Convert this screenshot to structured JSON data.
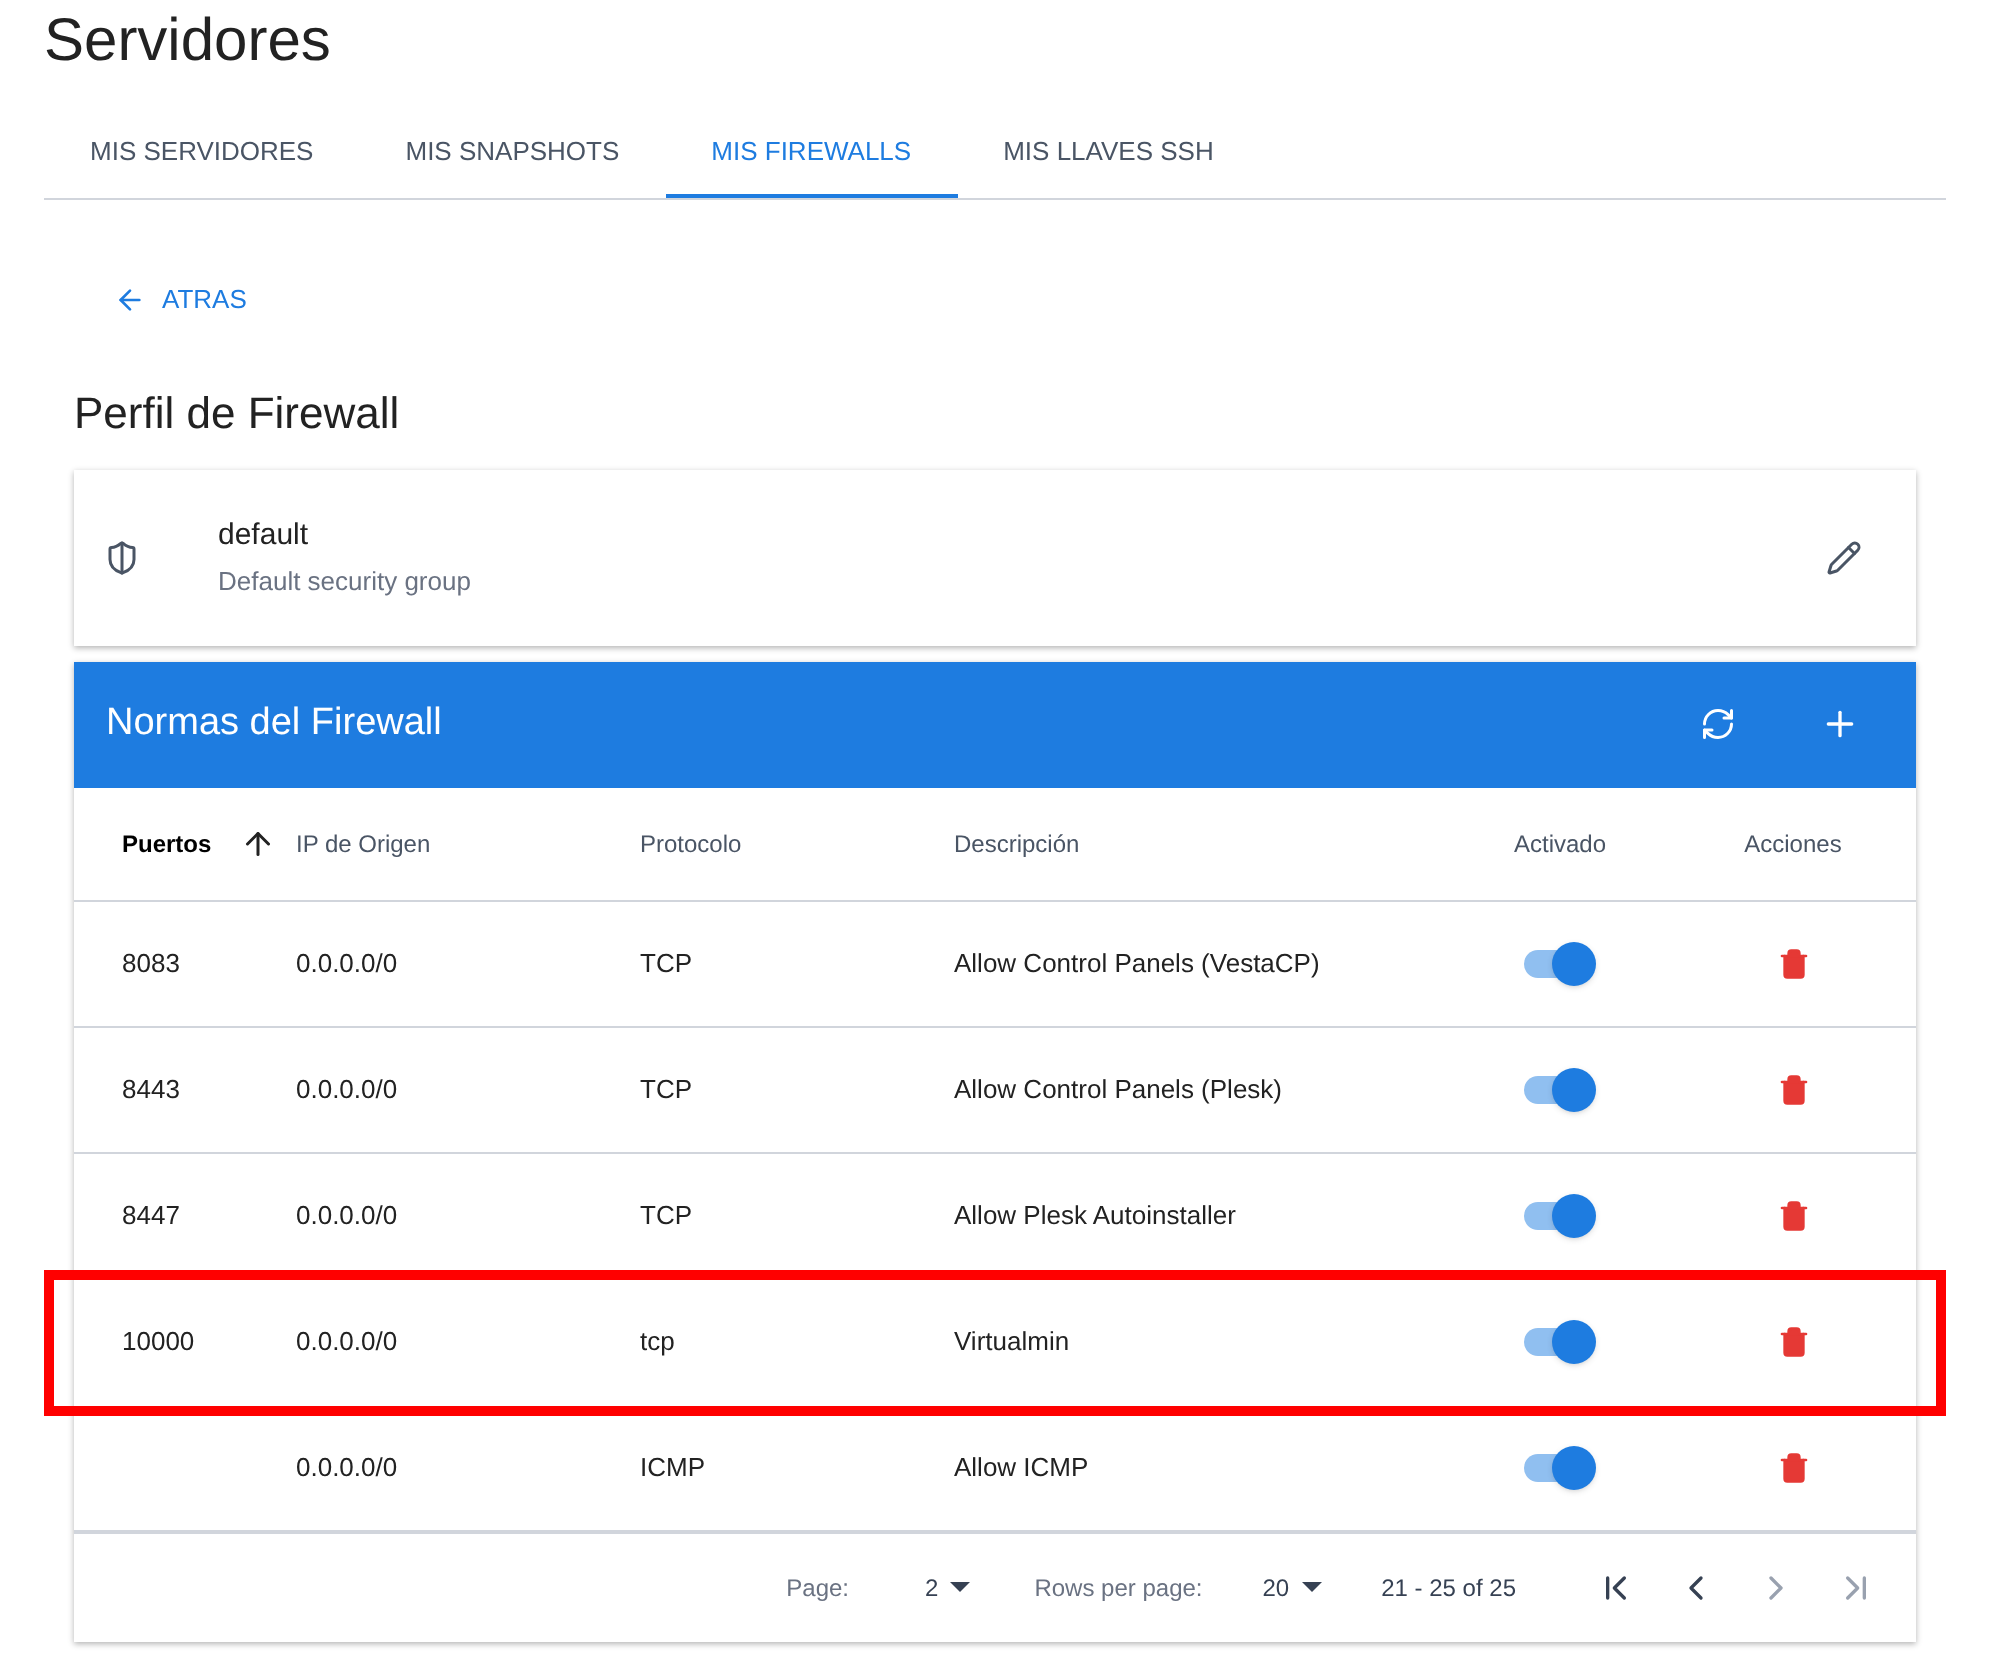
{
  "page_title": "Servidores",
  "tabs": [
    {
      "label": "MIS SERVIDORES",
      "selected": false
    },
    {
      "label": "MIS SNAPSHOTS",
      "selected": false
    },
    {
      "label": "MIS FIREWALLS",
      "selected": true
    },
    {
      "label": "MIS LLAVES SSH",
      "selected": false
    }
  ],
  "back_link": "ATRAS",
  "section_title": "Perfil de Firewall",
  "profile": {
    "name": "default",
    "description": "Default security group"
  },
  "rules_table": {
    "title": "Normas del Firewall",
    "columns": [
      {
        "label": "Puertos",
        "sorted": true
      },
      {
        "label": "IP de Origen",
        "sorted": false
      },
      {
        "label": "Protocolo",
        "sorted": false
      },
      {
        "label": "Descripción",
        "sorted": false
      },
      {
        "label": "Activado",
        "sorted": false
      },
      {
        "label": "Acciones",
        "sorted": false
      }
    ],
    "rows": [
      {
        "port": "8083",
        "source_ip": "0.0.0.0/0",
        "protocol": "TCP",
        "description": "Allow Control Panels (VestaCP)",
        "enabled": true,
        "highlighted": false
      },
      {
        "port": "8443",
        "source_ip": "0.0.0.0/0",
        "protocol": "TCP",
        "description": "Allow Control Panels (Plesk)",
        "enabled": true,
        "highlighted": false
      },
      {
        "port": "8447",
        "source_ip": "0.0.0.0/0",
        "protocol": "TCP",
        "description": "Allow Plesk Autoinstaller",
        "enabled": true,
        "highlighted": false
      },
      {
        "port": "10000",
        "source_ip": "0.0.0.0/0",
        "protocol": "tcp",
        "description": "Virtualmin",
        "enabled": true,
        "highlighted": true
      },
      {
        "port": "",
        "source_ip": "0.0.0.0/0",
        "protocol": "ICMP",
        "description": "Allow ICMP",
        "enabled": true,
        "highlighted": false
      }
    ],
    "pagination": {
      "page_label": "Page:",
      "page": "2",
      "rows_label": "Rows per page:",
      "rows_per_page": "20",
      "range": "21 - 25 of 25",
      "nav": [
        {
          "kind": "first",
          "disabled": false
        },
        {
          "kind": "prev",
          "disabled": false
        },
        {
          "kind": "next",
          "disabled": true
        },
        {
          "kind": "last",
          "disabled": true
        }
      ]
    }
  }
}
